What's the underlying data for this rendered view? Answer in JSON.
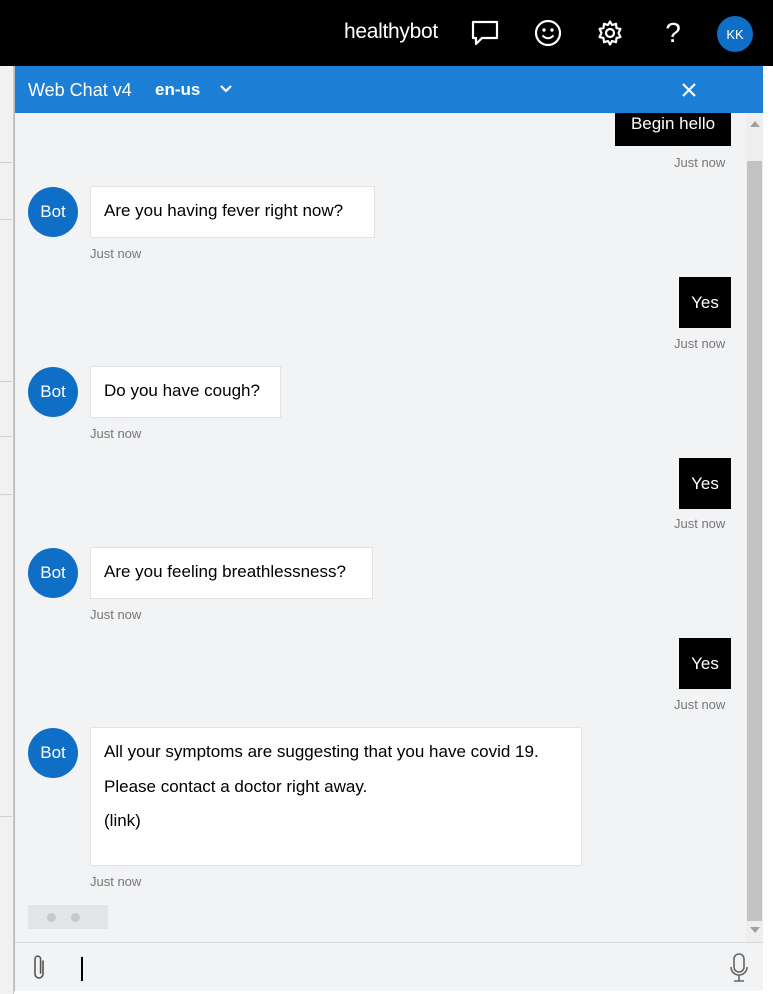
{
  "topbar": {
    "brand": "healthybot",
    "icons": [
      "chat-icon",
      "smiley-icon",
      "gear-icon",
      "help-icon"
    ],
    "help_glyph": "?",
    "avatar_initials": "KK"
  },
  "chat": {
    "header": {
      "title": "Web Chat v4",
      "language": "en-us"
    },
    "messages": [
      {
        "from": "user",
        "text": "Begin hello",
        "time": "Just now"
      },
      {
        "from": "bot",
        "avatar": "Bot",
        "lines": [
          "Are you having fever right now?"
        ],
        "time": "Just now"
      },
      {
        "from": "user",
        "text": "Yes",
        "time": "Just now"
      },
      {
        "from": "bot",
        "avatar": "Bot",
        "lines": [
          "Do you have cough?"
        ],
        "time": "Just now"
      },
      {
        "from": "user",
        "text": "Yes",
        "time": "Just now"
      },
      {
        "from": "bot",
        "avatar": "Bot",
        "lines": [
          "Are you feeling breathlessness?"
        ],
        "time": "Just now"
      },
      {
        "from": "user",
        "text": "Yes",
        "time": "Just now"
      },
      {
        "from": "bot",
        "avatar": "Bot",
        "lines": [
          "All your symptoms are suggesting that you have covid 19.",
          "Please contact a doctor right away.",
          "(link)"
        ],
        "time": "Just now"
      }
    ],
    "sendbox": {
      "value": ""
    }
  },
  "colors": {
    "topbar_bg": "#000000",
    "header_bg": "#1d7ed6",
    "bot_avatar": "#0f6fc6",
    "user_bubble": "#000000",
    "transcript_bg": "#f2f3f5"
  }
}
